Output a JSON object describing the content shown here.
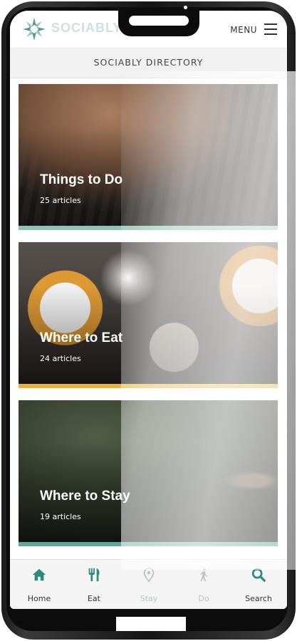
{
  "header": {
    "logo_text": "SOCIABLY",
    "menu_label": "MENU"
  },
  "directory": {
    "title": "SOCIABLY DIRECTORY"
  },
  "cards": [
    {
      "title": "Things to Do",
      "count": "25 articles",
      "strip_color": "#8fc3b4"
    },
    {
      "title": "Where to Eat",
      "count": "24 articles",
      "strip_color": "#e6b43a"
    },
    {
      "title": "Where to Stay",
      "count": "19 articles",
      "strip_color": "#5fa79a"
    }
  ],
  "tabs": [
    {
      "label": "Home",
      "icon": "home-icon",
      "color": "#2e8a7f"
    },
    {
      "label": "Eat",
      "icon": "fork-knife-icon",
      "color": "#2e8a7f"
    },
    {
      "label": "Stay",
      "icon": "location-pin-icon",
      "color": "#b9c4c2"
    },
    {
      "label": "Do",
      "icon": "walking-person-icon",
      "color": "#b9c4c2"
    },
    {
      "label": "Search",
      "icon": "search-icon",
      "color": "#2e8a7f"
    }
  ],
  "colors": {
    "brand": "#2e8a7f",
    "brand_light": "#8fc3b4"
  }
}
